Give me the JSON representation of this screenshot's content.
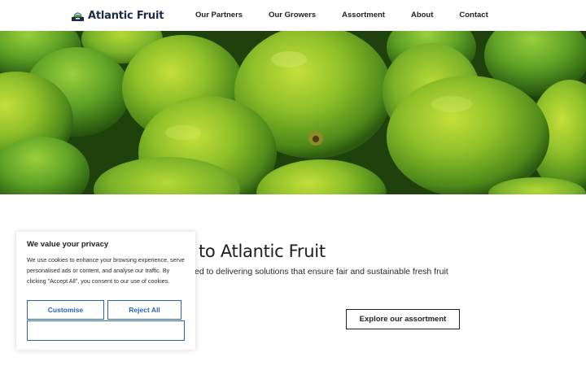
{
  "header": {
    "brand": "Atlantic Fruit",
    "nav": [
      {
        "label": "Our Partners"
      },
      {
        "label": "Our Growers"
      },
      {
        "label": "Assortment"
      },
      {
        "label": "About"
      },
      {
        "label": "Contact"
      }
    ]
  },
  "hero": {
    "image_icon": "limes-photo"
  },
  "welcome": {
    "title": "e to Atlantic Fruit",
    "text": "cated to delivering solutions that ensure fair and sustainable fresh fruit",
    "button_label": "Explore our assortment"
  },
  "cookie": {
    "title": "We value your privacy",
    "text": "We use cookies to enhance your browsing experience, serve personalised ads or content, and analyse our traffic. By clicking \"Accept All\", you consent to our use of cookies.",
    "customise_label": "Customise",
    "reject_label": "Reject All",
    "accept_label": ""
  },
  "colors": {
    "accent_blue": "#2c63b5",
    "brand_navy": "#1c2b4a",
    "lime_green": "#7fb227"
  }
}
